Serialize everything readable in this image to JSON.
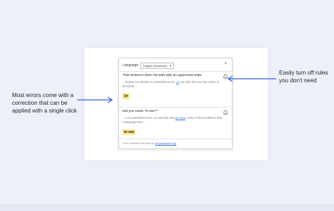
{
  "callouts": {
    "left": "Most errors come with a correction that can be applied with a single click",
    "right": "Easily turn off rules you don't need"
  },
  "popup": {
    "language_label": "Language",
    "language_value": "English (American)",
    "close_label": "×",
    "issues": [
      {
        "title": "This sentence does not start with an uppercase letter",
        "context_pre": "...hrases for details on potential errors.",
        "context_hl": "or",
        "context_post": "use this text too see a few of the prob...",
        "suggestion": "Or",
        "icon": "bell-icon"
      },
      {
        "title": "Did you mean \"to see\"?",
        "context_pre": "...s on potential errors. or use this text",
        "context_hl": "too see",
        "context_post": "a few of the problems that LanguageTool...",
        "suggestion": "to see",
        "icon": "bell-icon"
      }
    ],
    "footer_prefix": "Text checked remotely by",
    "footer_link": "languagetool.org"
  },
  "colors": {
    "background": "#eef0f8",
    "arrow": "#2f5ee0",
    "suggestion_bg": "#fde68a",
    "link": "#2a6fdb"
  }
}
